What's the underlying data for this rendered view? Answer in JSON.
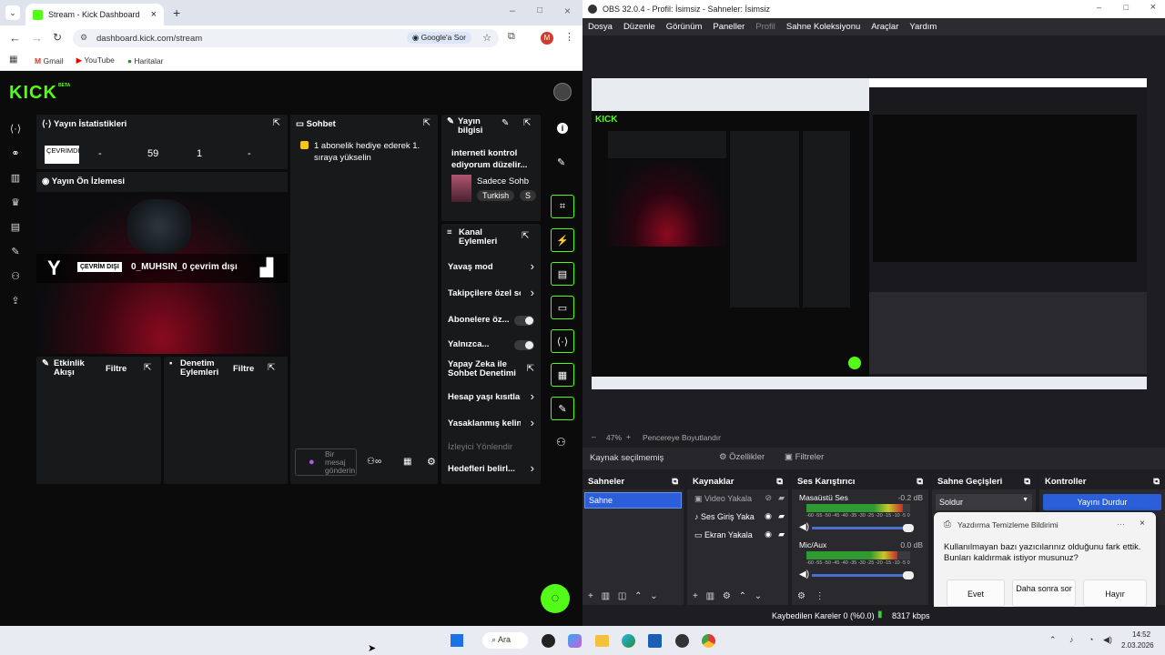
{
  "chrome": {
    "tab_title": "Stream - Kick Dashboard",
    "url": "dashboard.kick.com/stream",
    "translate_label": "Google'a Sor",
    "profile_letter": "M",
    "bookmarks": [
      "Gmail",
      "YouTube",
      "Haritalar"
    ]
  },
  "kick": {
    "logo": "KICK",
    "logo_badge": "BETA",
    "stats": {
      "title": "Yayın İstatistikleri",
      "offline_badge": "ÇEVRİMDIŞI",
      "values": [
        "-",
        "59",
        "1",
        "-"
      ]
    },
    "preview": {
      "title": "Yayın Ön İzlemesi",
      "offline_badge": "ÇEVRİM DIŞI",
      "offline_text": "0_MUHSIN_0 çevrim dışı"
    },
    "activity": {
      "title": "Etkinlik Akışı",
      "filter": "Filtre"
    },
    "moderation": {
      "title": "Denetim Eylemleri",
      "filter": "Filtre"
    },
    "chat": {
      "title": "Sohbet",
      "message": "1 abonelik hediye ederek 1. sıraya yükselin",
      "input_placeholder": "Bir mesaj gönderin"
    },
    "stream_info": {
      "title": "Yayın bilgisi",
      "stream_title": "interneti kontrol ediyorum düzelir...",
      "category": "Sadece Sohb",
      "tag1": "Turkish",
      "tag2": "S"
    },
    "channel_actions": {
      "title": "Kanal Eylemleri",
      "items": [
        {
          "label": "Yavaş mod",
          "control": "arrow"
        },
        {
          "label": "Takipçilere özel so",
          "control": "arrow"
        },
        {
          "label": "Abonelere öz...",
          "control": "toggle"
        },
        {
          "label": "Yalnızca...",
          "control": "toggle"
        },
        {
          "label": "Yapay Zeka ile Sohbet Denetimi",
          "control": "external"
        },
        {
          "label": "Hesap yaşı kısıtlar",
          "control": "arrow"
        },
        {
          "label": "Yasaklanmış kelin",
          "control": "arrow"
        },
        {
          "label": "İzleyici Yönlendir",
          "control": "none"
        },
        {
          "label": "Hedefleri belirl...",
          "control": "arrow"
        }
      ]
    }
  },
  "obs": {
    "title": "OBS 32.0.4 - Profil: İsimsiz - Sahneler: İsimsiz",
    "menu": [
      "Dosya",
      "Düzenle",
      "Görünüm",
      "Paneller",
      "Profil",
      "Sahne Koleksiyonu",
      "Araçlar",
      "Yardım"
    ],
    "zoom": "47%",
    "zoom_mode": "Pencereye Boyutlandır",
    "no_source": "Kaynak seçilmemiş",
    "properties": "Özellikler",
    "filters": "Filtreler",
    "scenes": {
      "title": "Sahneler",
      "items": [
        "Sahne"
      ]
    },
    "sources": {
      "title": "Kaynaklar",
      "items": [
        "Video Yakala",
        "Ses Giriş Yaka",
        "Ekran Yakala"
      ]
    },
    "mixer": {
      "title": "Ses Karıştırıcı",
      "channels": [
        {
          "name": "Masaüstü Ses",
          "db": "-0.2 dB",
          "level": 0.93
        },
        {
          "name": "Mic/Aux",
          "db": "0.0 dB",
          "level": 0.88
        }
      ],
      "scale": "-60 -55 -50 -45 -40 -35 -30 -25 -20 -15 -10 -5 0"
    },
    "transitions": {
      "title": "Sahne Geçişleri",
      "value": "Soldur"
    },
    "controls": {
      "title": "Kontroller",
      "stop_stream": "Yayını Durdur"
    },
    "notification": {
      "title": "Yazdırma Temizleme Bildirimi",
      "body": "Kullanılmayan bazı yazıcılarınız olduğunu fark ettik. Bunları kaldırmak istiyor musunuz?",
      "yes": "Evet",
      "later": "Daha sonra sor",
      "no": "Hayır"
    },
    "status": {
      "dropped": "Kaybedilen Kareler 0 (%0.0)",
      "bitrate": "8317 kbps"
    }
  },
  "taskbar": {
    "search": "Ara",
    "time": "14:52",
    "date": "2.03.2026"
  },
  "colors": {
    "kick_green": "#53fc18",
    "obs_blue": "#2b5fd9"
  }
}
